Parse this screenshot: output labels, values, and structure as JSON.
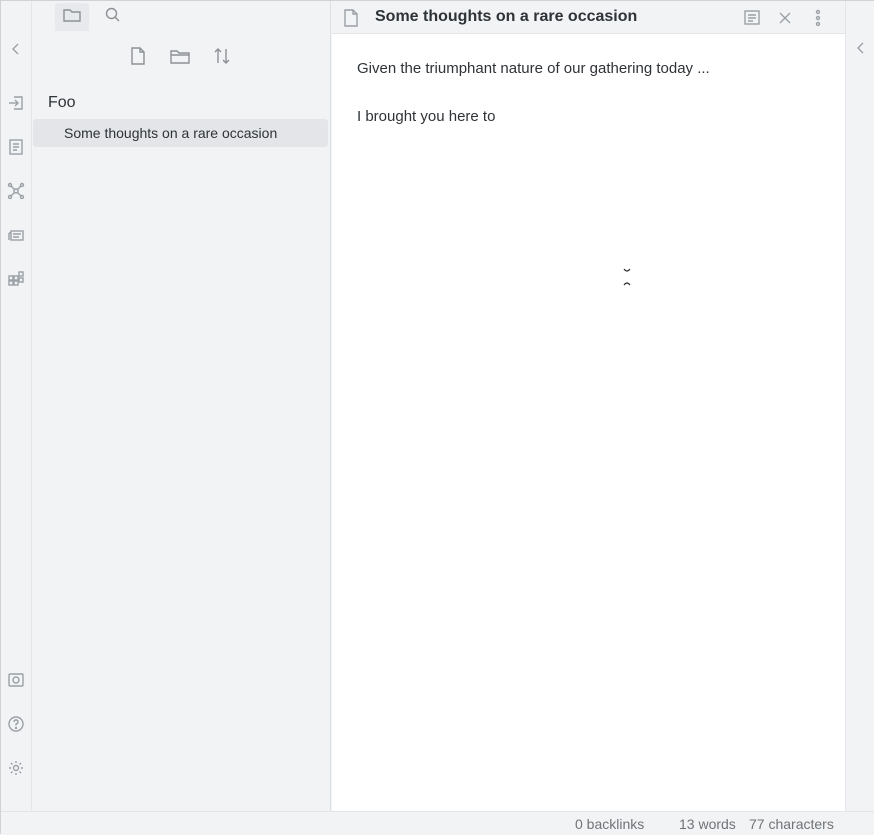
{
  "sidebar": {
    "tabs": [
      {
        "icon": "folder-icon"
      },
      {
        "icon": "search-icon"
      }
    ],
    "actions": [
      {
        "icon": "new-note-icon"
      },
      {
        "icon": "new-folder-icon"
      },
      {
        "icon": "sort-icon"
      }
    ],
    "folder": "Foo",
    "files": [
      {
        "name": "Some thoughts on a rare occasion"
      }
    ]
  },
  "pane": {
    "title": "Some thoughts on a rare occasion",
    "header_icons": [
      "file-icon",
      "reading-view-icon",
      "close-icon",
      "more-options-icon"
    ],
    "paragraphs": [
      "Given the triumphant nature of our gathering today ...",
      "I brought you here to"
    ]
  },
  "ribbon": {
    "icons": [
      "collapse-left-icon",
      "open-quick-switcher-icon",
      "daily-note-icon",
      "graph-view-icon",
      "slides-icon",
      "command-palette-icon",
      "vault-icon",
      "help-icon",
      "settings-icon"
    ]
  },
  "statusbar": {
    "backlinks": "0 backlinks",
    "words": "13 words",
    "characters": "77 characters"
  }
}
